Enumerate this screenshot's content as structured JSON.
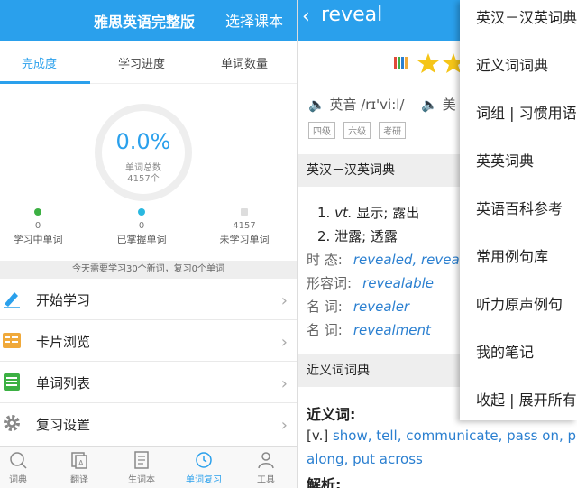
{
  "left": {
    "header": {
      "title": "雅思英语完整版",
      "choose": "选择课本"
    },
    "tabs": [
      {
        "label": "完成度"
      },
      {
        "label": "学习进度"
      },
      {
        "label": "单词数量"
      }
    ],
    "progress": {
      "percent": "0.0%",
      "caption": "单词总数",
      "count": "4157个"
    },
    "stats": [
      {
        "num": "0",
        "label": "学习中单词",
        "color": "#3cb043"
      },
      {
        "num": "0",
        "label": "已掌握单词",
        "color": "#2ab8e0"
      },
      {
        "num": "4157",
        "label": "未学习单词",
        "color": "#dddddd"
      }
    ],
    "notice": "今天需要学习30个新词，复习0个单词",
    "menu": [
      {
        "label": "开始学习",
        "icon": "pencil-icon"
      },
      {
        "label": "卡片浏览",
        "icon": "card-icon"
      },
      {
        "label": "单词列表",
        "icon": "list-icon"
      },
      {
        "label": "复习设置",
        "icon": "gear-icon"
      }
    ],
    "nav": [
      {
        "label": "词典"
      },
      {
        "label": "翻译"
      },
      {
        "label": "生词本"
      },
      {
        "label": "单词复习"
      },
      {
        "label": "工具"
      }
    ]
  },
  "right": {
    "word": "reveal",
    "pron_uk": "英音 /rɪ'vi:l/",
    "pron_us_prefix": "美",
    "tags": [
      "四级",
      "六级",
      "考研"
    ],
    "section1": "英汉－汉英词典",
    "defs": [
      {
        "num": "1.",
        "pos": "vt.",
        "text": " 显示; 露出"
      },
      {
        "num": "2.",
        "pos": "",
        "text": " 泄露; 透露"
      }
    ],
    "forms": [
      {
        "label": "时 态:",
        "value": "revealed, revea"
      },
      {
        "label": "形容词:",
        "value": "revealable"
      },
      {
        "label": "名 词:",
        "value": "revealer"
      },
      {
        "label": "名 词:",
        "value": "revealment"
      }
    ],
    "section2": "近义词词典",
    "syn_title": "近义词:",
    "syn_line1_tag": "[v.] ",
    "syn_line1": "show, tell, communicate, pass on, p",
    "syn_line2": "along, put across",
    "next_title": "解析:"
  },
  "dropdown": [
    "英汉－汉英词典",
    "近义词词典",
    "词组 | 习惯用语",
    "英英词典",
    "英语百科参考",
    "常用例句库",
    "听力原声例句",
    "我的笔记",
    "收起 | 展开所有"
  ]
}
